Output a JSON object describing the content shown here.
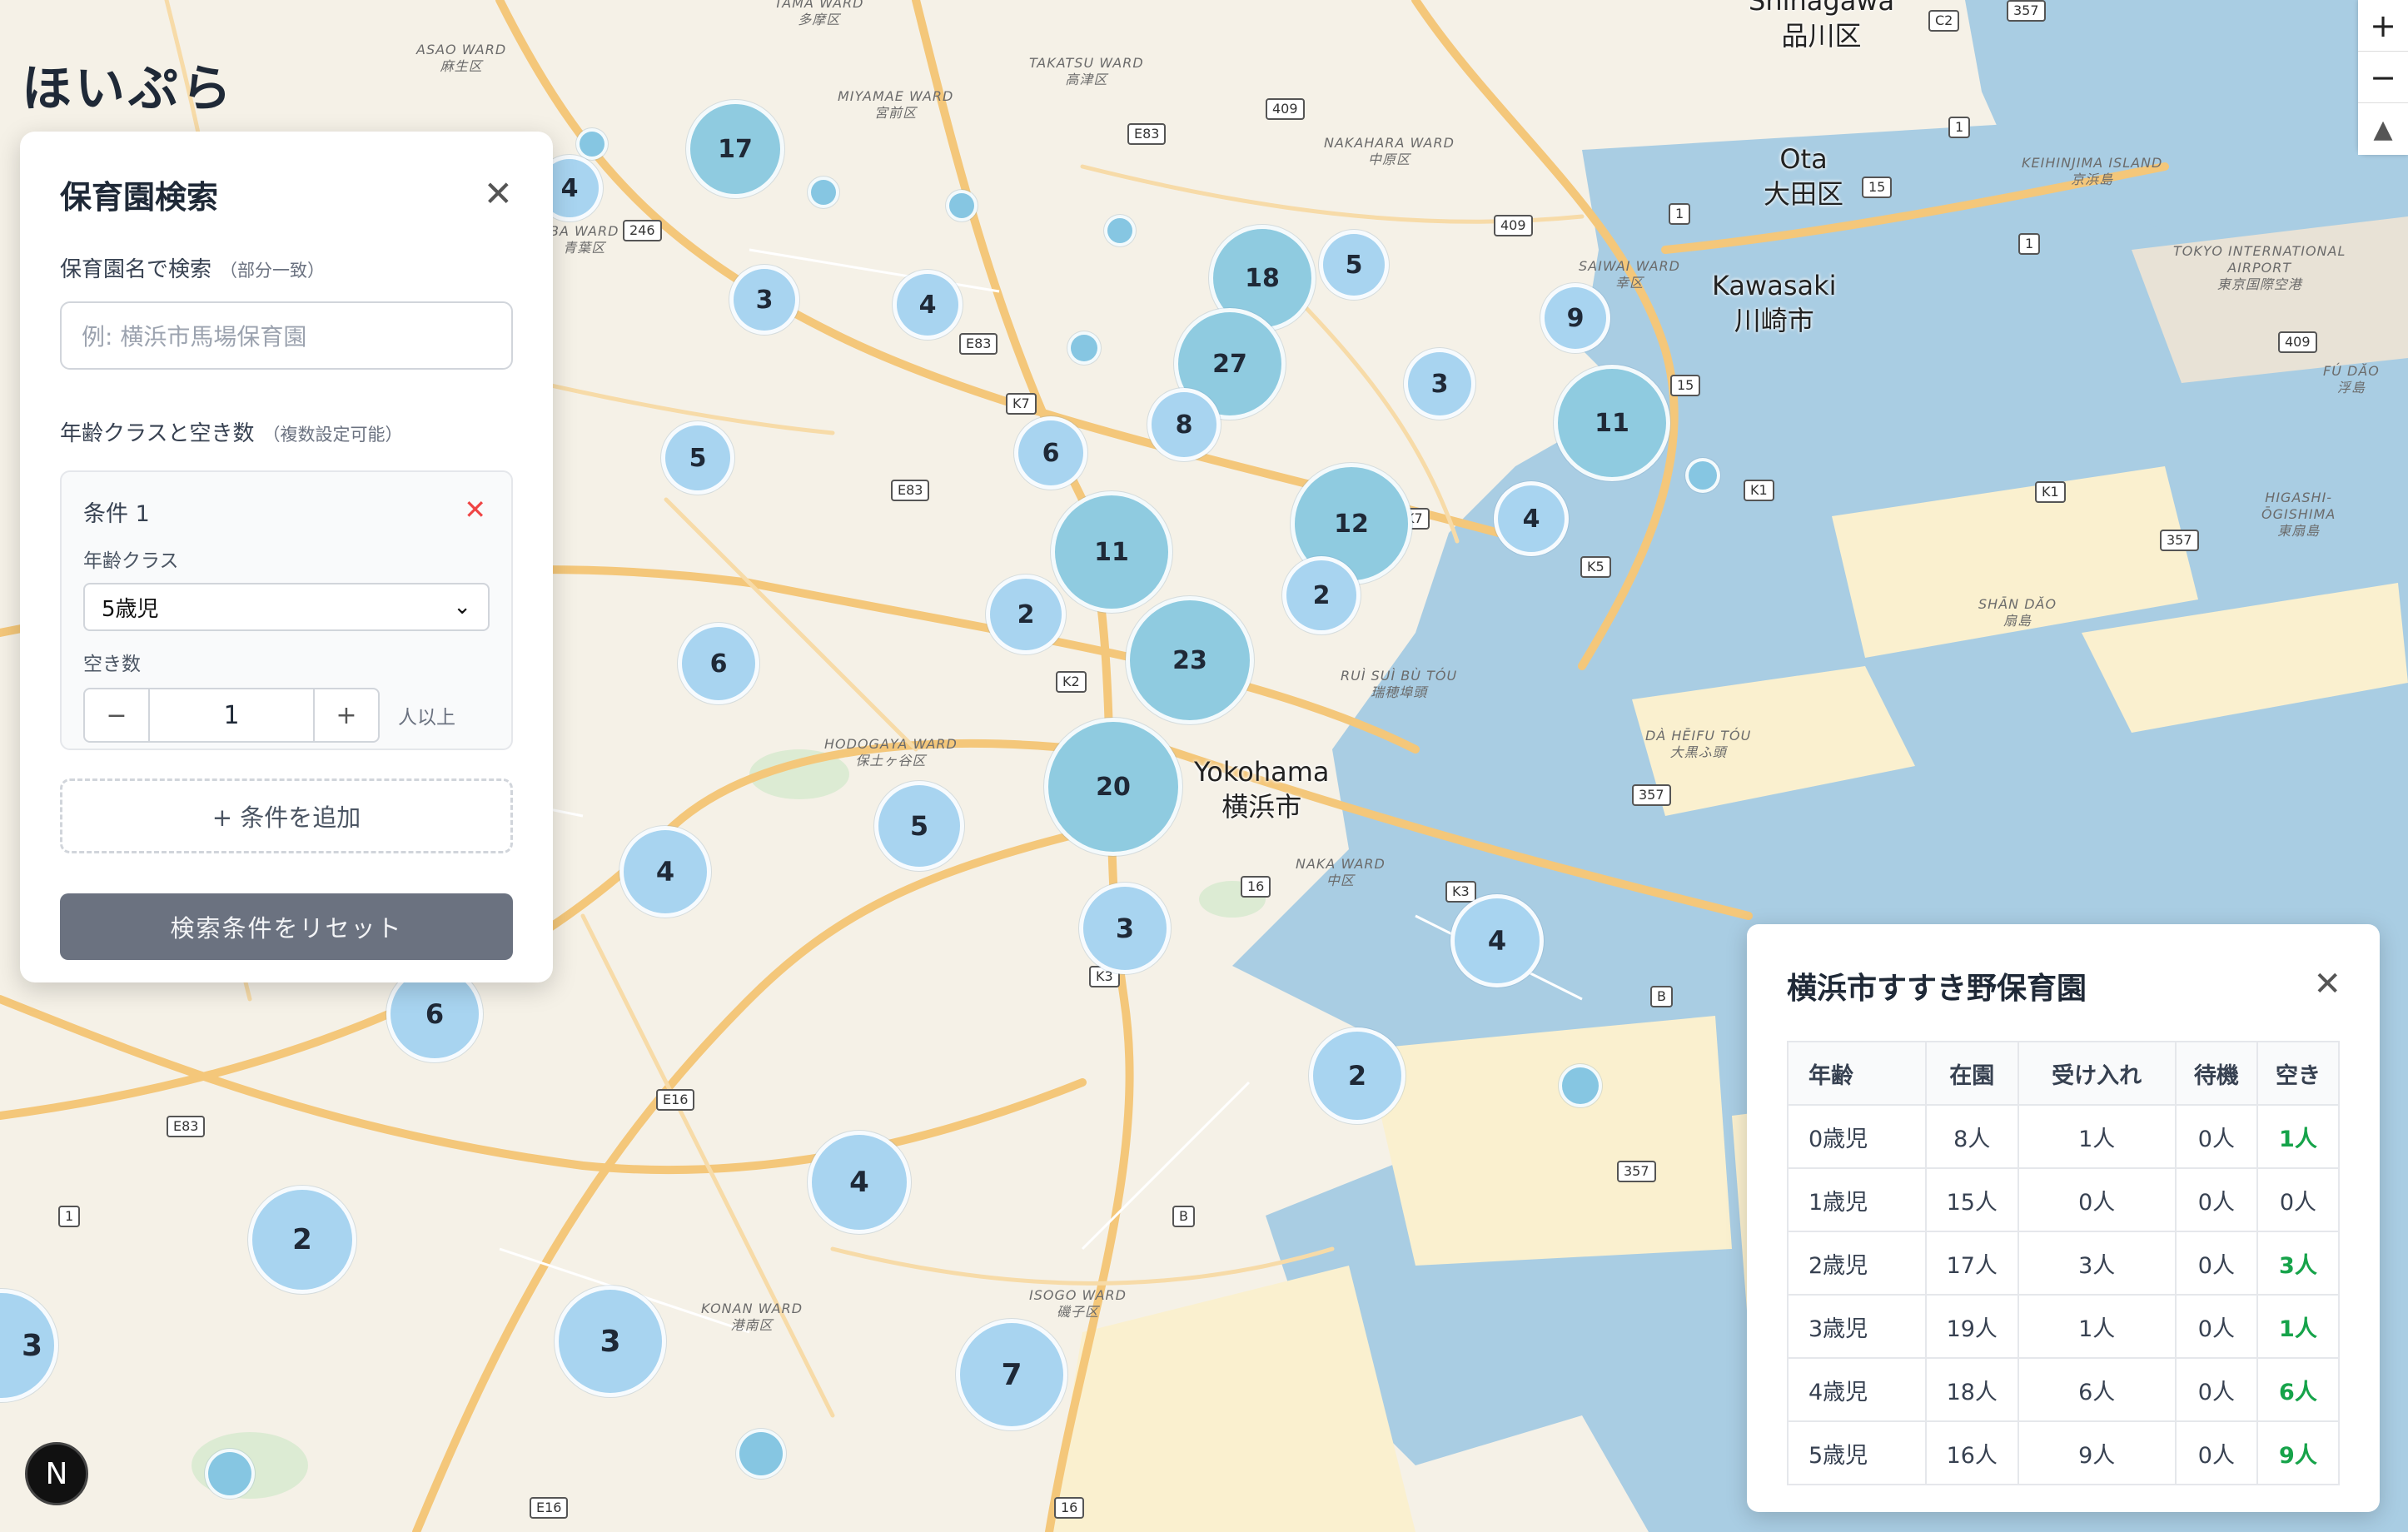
{
  "app": {
    "brand": "ほいぷら"
  },
  "map_controls": {
    "zoom_in": "+",
    "zoom_out": "−",
    "compass": "▲"
  },
  "clusters": [
    {
      "label": "17"
    },
    {
      "label": "4"
    },
    {
      "label": "3"
    },
    {
      "label": "4"
    },
    {
      "label": "18"
    },
    {
      "label": "5"
    },
    {
      "label": "27"
    },
    {
      "label": "9"
    },
    {
      "label": "3"
    },
    {
      "label": "11"
    },
    {
      "label": "5"
    },
    {
      "label": "6"
    },
    {
      "label": "8"
    },
    {
      "label": "12"
    },
    {
      "label": "4"
    },
    {
      "label": "11"
    },
    {
      "label": "2"
    },
    {
      "label": "2"
    },
    {
      "label": "6"
    },
    {
      "label": "23"
    },
    {
      "label": "20"
    },
    {
      "label": "5"
    },
    {
      "label": "4"
    },
    {
      "label": "3"
    },
    {
      "label": "4"
    },
    {
      "label": "6"
    },
    {
      "label": "2"
    },
    {
      "label": "4"
    },
    {
      "label": "2"
    },
    {
      "label": "3"
    },
    {
      "label": "7"
    },
    {
      "label": "3"
    }
  ],
  "map_labels": {
    "asao": "ASAO WARD\n麻生区",
    "tama": "TAMA WARD\n多摩区",
    "takatsu": "TAKATSU WARD\n高津区",
    "miyamae": "MIYAMAE WARD\n宮前区",
    "nakahara": "NAKAHARA WARD\n中原区",
    "saiwai": "SAIWAI WARD\n幸区",
    "aoba": "BA WARD\n青葉区",
    "keihinjima": "KEIHINJIMA ISLAND\n京浜島",
    "airport": "TOKYO INTERNATIONAL\nAIRPORT\n東京国際空港",
    "fudao": "FÚ DĂO\n浮島",
    "higashi": "HIGASHI-\nŌGISHIMA\n東扇島",
    "shandao": "SHĀN DĂO\n扇島",
    "ruisui": "RUÌ SUÌ BÙ TÓU\n瑞穂埠頭",
    "daheifu": "DÀ HĒIFU TÓU\n大黒ふ頭",
    "hodogaya": "HODOGAYA WARD\n保土ヶ谷区",
    "naka": "NAKA WARD\n中区",
    "konan": "KONAN WARD\n港南区",
    "isogo": "ISOGO WARD\n磯子区"
  },
  "cities": {
    "shinagawa": "Shinagawa\n品川区",
    "ota": "Ota\n大田区",
    "kawasaki": "Kawasaki\n川崎市",
    "yokohama": "Yokohama\n横浜市"
  },
  "shields": [
    "E83",
    "246",
    "409",
    "409",
    "15",
    "1",
    "1",
    "1",
    "409",
    "15",
    "K1",
    "357",
    "K5",
    "K7",
    "E83",
    "E83",
    "K2",
    "357",
    "16",
    "K3",
    "B",
    "B",
    "357",
    "E16",
    "E83",
    "1",
    "E16",
    "16",
    "K7",
    "K1",
    "357",
    "C2",
    "K3"
  ],
  "search_panel": {
    "title": "保育園検索",
    "close": "✕",
    "name_label": "保育園名で検索",
    "name_hint": "（部分一致）",
    "name_placeholder": "例: 横浜市馬場保育園",
    "age_label": "年齢クラスと空き数",
    "age_hint": "（複数設定可能）",
    "condition": {
      "title": "条件 1",
      "remove": "✕",
      "class_label": "年齢クラス",
      "class_value": "5歳児",
      "vacancy_label": "空き数",
      "minus": "−",
      "value": "1",
      "plus": "+",
      "unit": "人以上"
    },
    "add_condition": "+ 条件を追加",
    "reset": "検索条件をリセット"
  },
  "detail_panel": {
    "title": "横浜市すすき野保育園",
    "close": "✕",
    "columns": [
      "年齢",
      "在園",
      "受け入れ",
      "待機",
      "空き"
    ],
    "rows": [
      [
        "0歳児",
        "8人",
        "1人",
        "0人",
        "1人"
      ],
      [
        "1歳児",
        "15人",
        "0人",
        "0人",
        "0人"
      ],
      [
        "2歳児",
        "17人",
        "3人",
        "0人",
        "3人"
      ],
      [
        "3歳児",
        "19人",
        "1人",
        "0人",
        "1人"
      ],
      [
        "4歳児",
        "18人",
        "6人",
        "0人",
        "6人"
      ],
      [
        "5歳児",
        "16人",
        "9人",
        "0人",
        "9人"
      ]
    ],
    "accent_color": "#16a34a"
  },
  "badge": {
    "label": "N"
  }
}
